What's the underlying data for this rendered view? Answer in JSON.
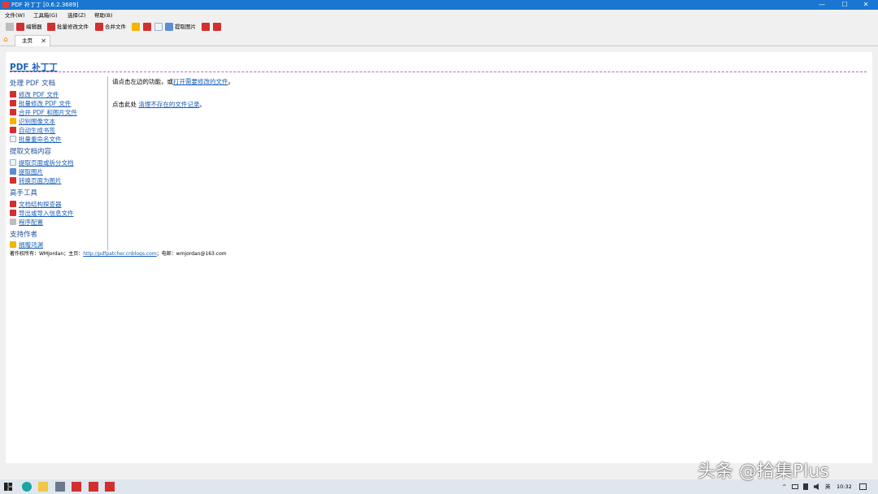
{
  "window": {
    "title": "PDF 补丁丁 [0.6.2.3689]",
    "controls": {
      "minimize": "—",
      "maximize": "☐",
      "close": "✕"
    }
  },
  "menu": {
    "items": [
      "文件(W)",
      "工具箱(G)",
      "选择(Z)",
      "帮助(B)"
    ]
  },
  "toolbar": {
    "editor": "编辑器",
    "batch_modify": "批量修改文件",
    "merge": "合并文件",
    "extract_images": "提取图片"
  },
  "tabs": [
    {
      "label": "主页",
      "close": "✕"
    }
  ],
  "content": {
    "title": "PDF 补丁丁",
    "sidebar": {
      "sections": [
        {
          "heading": "处理 PDF 文档",
          "items": [
            "修改 PDF 文件",
            "批量修改 PDF 文件",
            "合并 PDF 和图片文件",
            "识别图像文本",
            "自动生成书签",
            "批量重命名文件"
          ]
        },
        {
          "heading": "提取文档内容",
          "items": [
            "提取页面或拆分文档",
            "提取图片",
            "转换页面为图片"
          ]
        },
        {
          "heading": "高手工具",
          "items": [
            "文档结构探查器",
            "导出或导入信息文件",
            "程序配置"
          ]
        },
        {
          "heading": "支持作者",
          "items": [
            "捐赠鸿渊"
          ]
        }
      ]
    },
    "main": {
      "line1_prefix": "请点击左边的功能，或",
      "line1_link": "打开需要修改的文件",
      "line1_suffix": "。",
      "line2_prefix": "点击此处 ",
      "line2_link": "清理不存在的文件记录",
      "line2_suffix": "。"
    },
    "footer": {
      "prefix": "著作权所有：WMJordan；主页：",
      "link": "http://pdfpatcher.cnblogs.com",
      "suffix": "；电邮：wmjordan@163.com"
    }
  },
  "taskbar": {
    "tray": {
      "chevron": "^",
      "lang": "英",
      "time": "10:32"
    }
  },
  "watermark": "头条 @拾集Plus",
  "colors": {
    "titlebar": "#1976d2",
    "link": "#1a5fb4",
    "heading": "#2050a0"
  }
}
